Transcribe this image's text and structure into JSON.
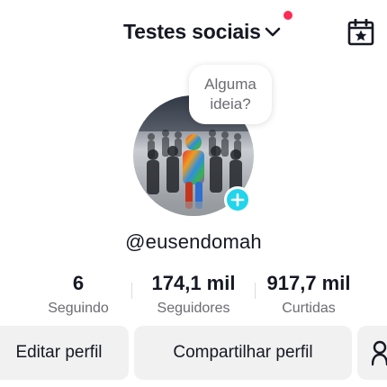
{
  "header": {
    "account_name": "Testes sociais",
    "has_notification": true
  },
  "idea_bubble": {
    "text": "Alguma ideia?"
  },
  "profile": {
    "username": "@eusendomah"
  },
  "stats": [
    {
      "value": "6",
      "label": "Seguindo"
    },
    {
      "value": "174,1 mil",
      "label": "Seguidores"
    },
    {
      "value": "917,7 mil",
      "label": "Curtidas"
    }
  ],
  "actions": {
    "edit_profile": "Editar perfil",
    "share_profile": "Compartilhar perfil"
  },
  "icons": {
    "account_switch": "chevron-down-icon",
    "calendar": "calendar-star-icon",
    "add_story": "plus-icon",
    "add_friend": "add-friend-icon"
  },
  "colors": {
    "notification_dot": "#fe2c55",
    "add_story": "#20d5ec",
    "button_bg": "#f1f1f2",
    "text_primary": "#161823",
    "text_secondary": "#6b6b72"
  }
}
